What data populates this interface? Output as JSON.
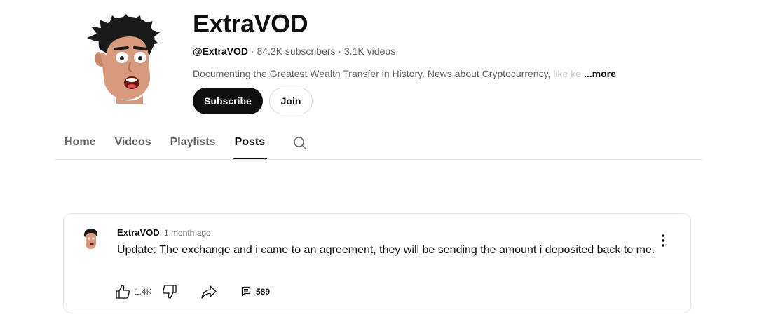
{
  "channel": {
    "name": "ExtraVOD",
    "handle": "@ExtraVOD",
    "stats": " · 84.2K subscribers · 3.1K videos",
    "description": "Documenting the Greatest Wealth Transfer in History. News about Cryptocurrency,",
    "description_faded": " like ke",
    "more_label": "...more",
    "avatar_icon": "channel-avatar"
  },
  "actions": {
    "subscribe_label": "Subscribe",
    "join_label": "Join"
  },
  "tabs": [
    {
      "label": "Home",
      "active": false
    },
    {
      "label": "Videos",
      "active": false
    },
    {
      "label": "Playlists",
      "active": false
    },
    {
      "label": "Posts",
      "active": true
    }
  ],
  "post": {
    "author": "ExtraVOD",
    "time": "1 month ago",
    "text": "Update: The exchange and i came to an agreement, they will be sending the amount i deposited back to me.",
    "likes": "1.4K",
    "comments": "589"
  },
  "icons": [
    "search-icon",
    "like-icon",
    "dislike-icon",
    "share-icon",
    "comment-icon",
    "more-vert-icon"
  ],
  "colors": {
    "primary_text": "#0f0f0f",
    "secondary_text": "#606060",
    "subscribe_bg": "#0f0f0f",
    "border": "#e5e5e5"
  }
}
